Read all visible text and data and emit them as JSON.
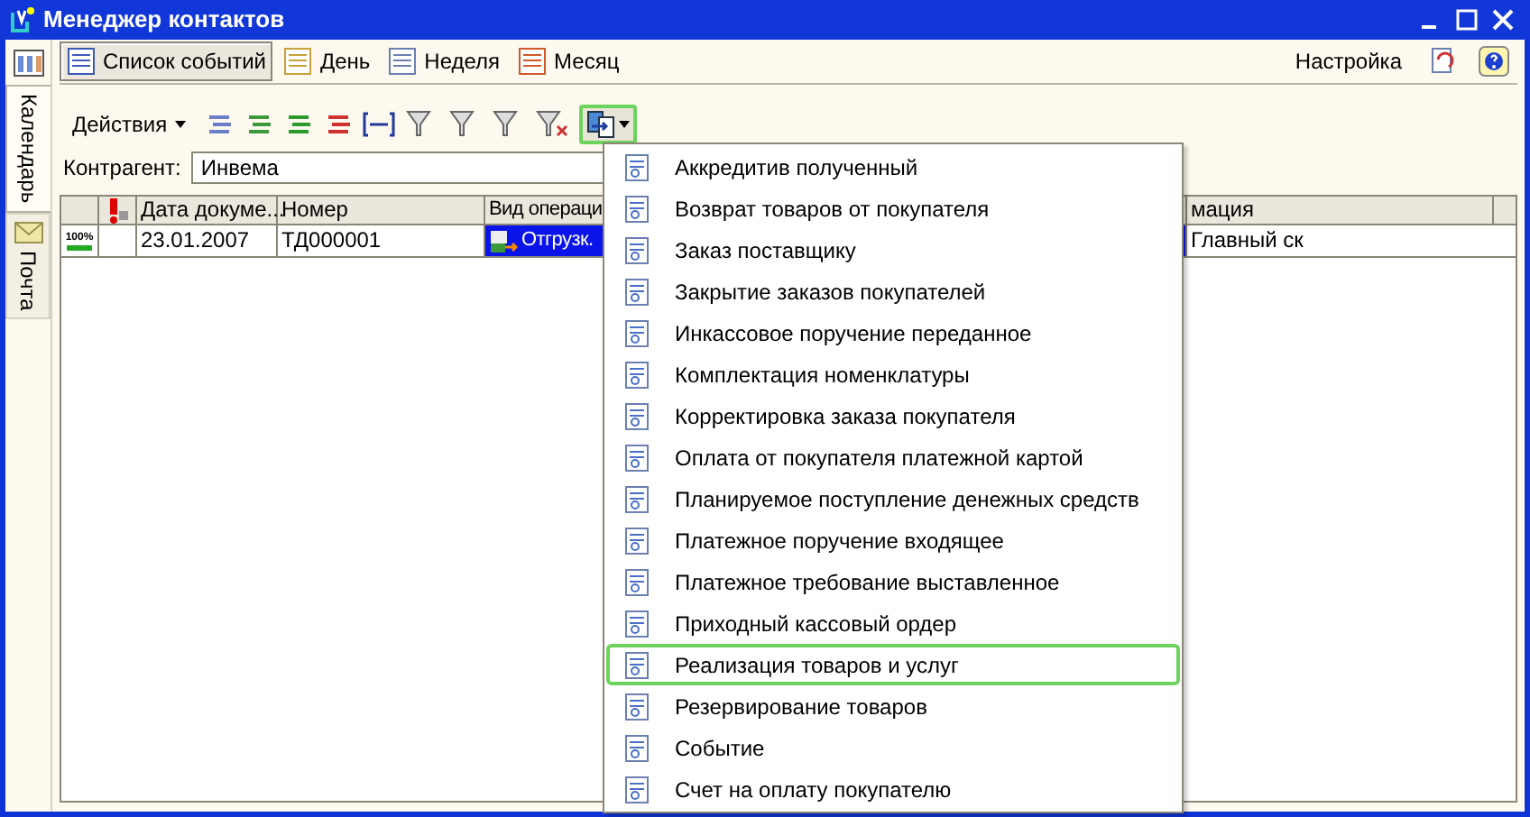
{
  "window": {
    "title": "Менеджер контактов"
  },
  "side_tabs": [
    {
      "label": "Календарь",
      "selected": true
    },
    {
      "label": "Почта",
      "selected": false
    }
  ],
  "view_buttons": [
    {
      "label": "Список событий",
      "selected": true
    },
    {
      "label": "День",
      "selected": false
    },
    {
      "label": "Неделя",
      "selected": false
    },
    {
      "label": "Месяц",
      "selected": false
    }
  ],
  "settings_label": "Настройка",
  "actions_menu": "Действия",
  "counterparty": {
    "label": "Контрагент:",
    "value": "Инвема"
  },
  "table": {
    "columns": [
      "Дата докуме...",
      "Номер",
      "Вид операци",
      "мация"
    ],
    "rows": [
      {
        "status": "100%",
        "date": "23.01.2007",
        "number": "ТД000001",
        "operation": "Отгрузк.",
        "column_4": "Главный ск",
        "selected": true
      }
    ]
  },
  "dropdown": [
    {
      "label": "Аккредитив полученный",
      "selected": false
    },
    {
      "label": "Возврат товаров от покупателя",
      "selected": false
    },
    {
      "label": "Заказ поставщику",
      "selected": false
    },
    {
      "label": "Закрытие заказов покупателей",
      "selected": false
    },
    {
      "label": "Инкассовое поручение переданное",
      "selected": false
    },
    {
      "label": "Комплектация номенклатуры",
      "selected": false
    },
    {
      "label": "Корректировка заказа покупателя",
      "selected": false
    },
    {
      "label": "Оплата от покупателя платежной картой",
      "selected": false
    },
    {
      "label": "Планируемое поступление денежных средств",
      "selected": false
    },
    {
      "label": "Платежное поручение входящее",
      "selected": false
    },
    {
      "label": "Платежное требование выставленное",
      "selected": false
    },
    {
      "label": "Приходный кассовый ордер",
      "selected": false
    },
    {
      "label": "Реализация товаров и услуг",
      "selected": true
    },
    {
      "label": "Резервирование товаров",
      "selected": false
    },
    {
      "label": "Событие",
      "selected": false
    },
    {
      "label": "Счет на оплату покупателю",
      "selected": false
    }
  ]
}
